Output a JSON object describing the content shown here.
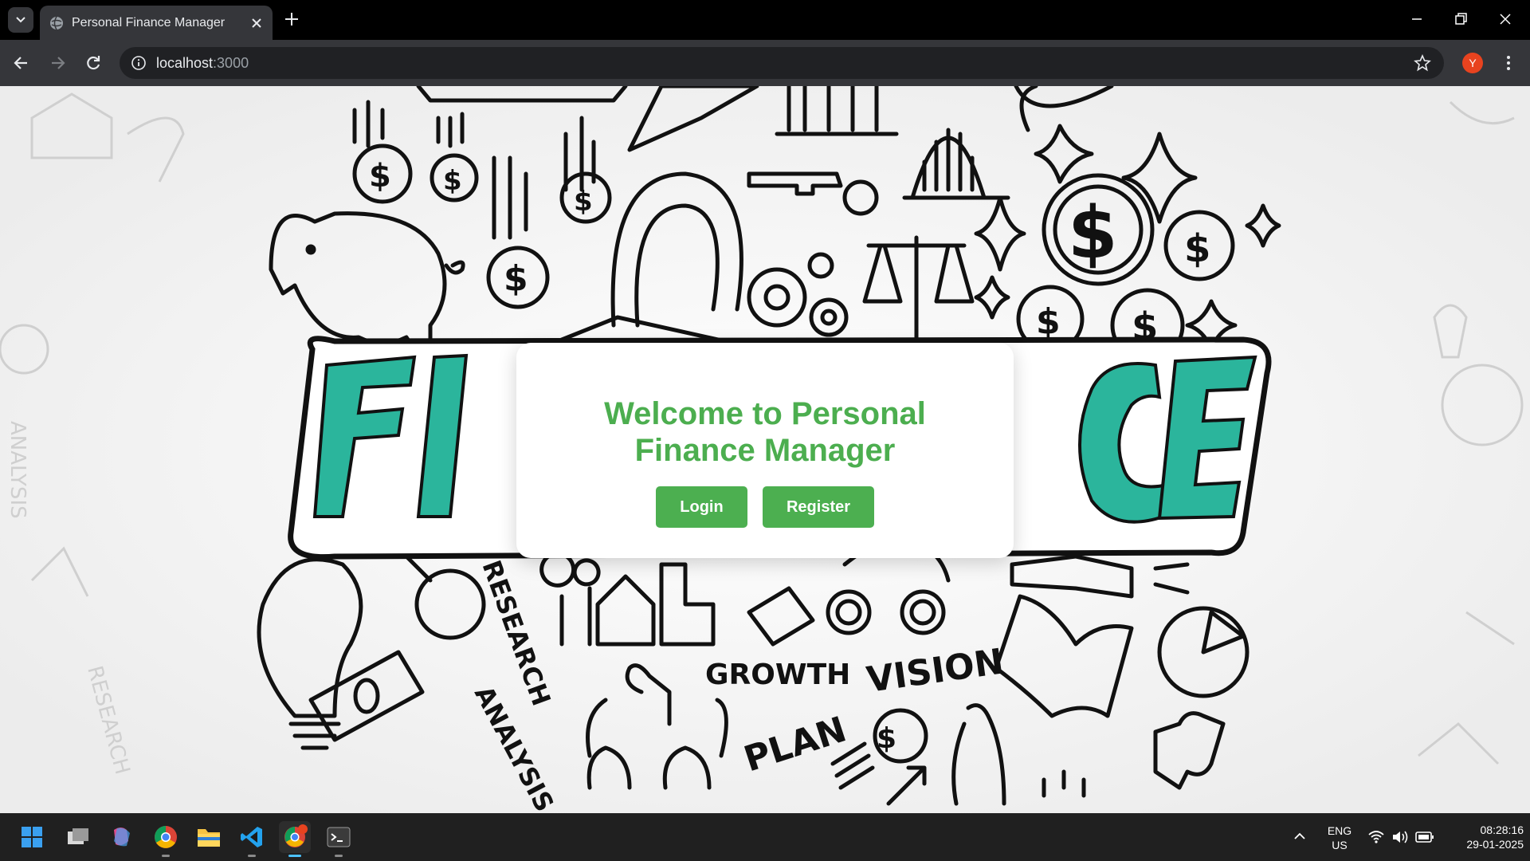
{
  "browser": {
    "tab_title": "Personal Finance Manager",
    "url_host": "localhost",
    "url_port": ":3000",
    "profile_initial": "Y"
  },
  "page": {
    "hero_word": "FINANCE",
    "doodle_words": [
      "GROWTH",
      "VISION",
      "PLAN",
      "RESEARCH",
      "ANALYSIS"
    ],
    "welcome_heading_line1": "Welcome to Personal",
    "welcome_heading_line2": "Finance Manager",
    "login_label": "Login",
    "register_label": "Register",
    "accent_color": "#4caf50",
    "hero_color": "#2bb59c"
  },
  "taskbar": {
    "apps": [
      "windows-start",
      "task-view",
      "copilot",
      "chrome",
      "file-explorer",
      "vscode",
      "chrome-profile",
      "terminal"
    ],
    "language": "ENG",
    "region": "US",
    "time": "08:28:16",
    "date": "29-01-2025"
  }
}
